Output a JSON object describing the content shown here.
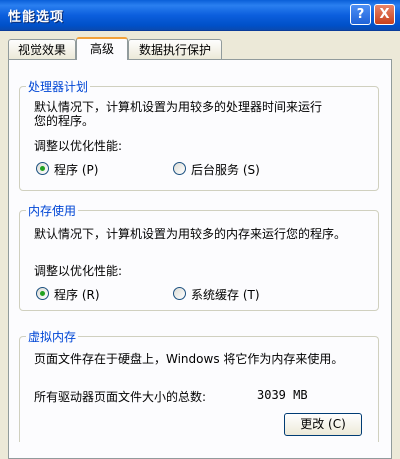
{
  "window": {
    "title": "性能选项",
    "help_symbol": "?",
    "close_symbol": "X"
  },
  "tabs": [
    {
      "label": "视觉效果"
    },
    {
      "label": "高级"
    },
    {
      "label": "数据执行保护"
    }
  ],
  "processor": {
    "title": "处理器计划",
    "desc_line1": "默认情况下，计算机设置为用较多的处理器时间来运行",
    "desc_line2": "您的程序。",
    "adjust_label": "调整以优化性能:",
    "options": [
      "程序 (P)",
      "后台服务 (S)"
    ],
    "selected": "程序 (P)"
  },
  "memory": {
    "title": "内存使用",
    "desc": "默认情况下，计算机设置为用较多的内存来运行您的程序。",
    "adjust_label": "调整以优化性能:",
    "options": [
      "程序 (R)",
      "系统缓存 (T)"
    ],
    "selected": "程序 (R)"
  },
  "virtual": {
    "title": "虚拟内存",
    "desc": "页面文件存在于硬盘上，Windows 将它作为内存来使用。",
    "total_label": "所有驱动器页面文件大小的总数:",
    "total_value": "3039 MB",
    "change_button": "更改 (C)"
  }
}
